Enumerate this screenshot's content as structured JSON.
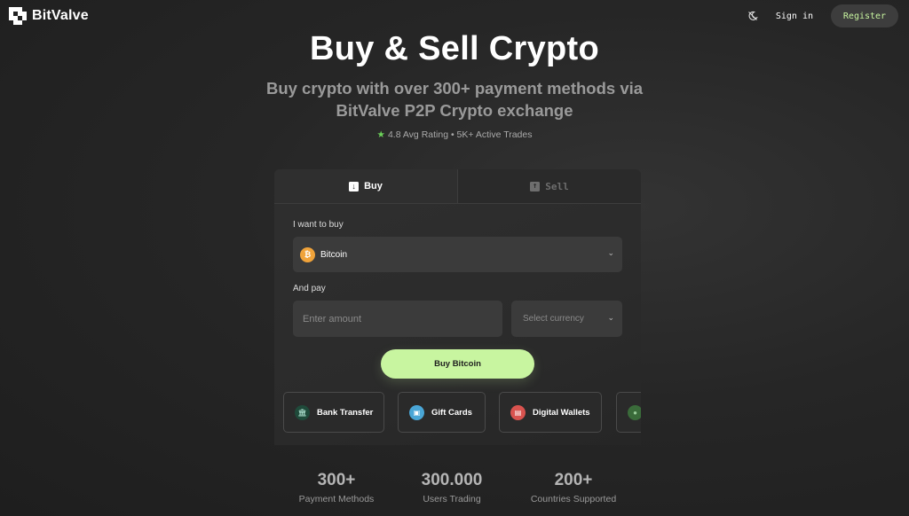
{
  "header": {
    "brand": "BitValve",
    "theme_icon": "moon-slash-icon",
    "signin_label": "Sign in",
    "register_label": "Register"
  },
  "hero": {
    "title": "Buy & Sell Crypto",
    "subtitle_line1": "Buy crypto with over 300+ payment methods via",
    "subtitle_line2": "BitValve P2P Crypto exchange",
    "rating_text": "4.8 Avg Rating • 5K+ Active Trades"
  },
  "card": {
    "tabs": [
      {
        "label": "Buy",
        "icon": "download-icon",
        "active": true
      },
      {
        "label": "Sell",
        "icon": "upload-icon",
        "active": false
      }
    ],
    "want_label": "I want to buy",
    "coin": {
      "name": "Bitcoin",
      "icon": "bitcoin-icon",
      "symbol": "₿"
    },
    "pay_label": "And pay",
    "amount_placeholder": "Enter amount",
    "currency_placeholder": "Select currency",
    "buy_button": "Buy Bitcoin"
  },
  "payment_methods": [
    {
      "label": "Bank Transfer",
      "icon": "bank-icon",
      "color": "#1f4a3a"
    },
    {
      "label": "Gift Cards",
      "icon": "gift-card-icon",
      "color": "#4aa6d6"
    },
    {
      "label": "Digital Wallets",
      "icon": "wallet-icon",
      "color": "#d9534f"
    },
    {
      "label": "",
      "icon": "crypto-icon",
      "color": "#3a6b3a"
    }
  ],
  "stats": [
    {
      "value": "300+",
      "label": "Payment Methods"
    },
    {
      "value": "300.000",
      "label": "Users Trading"
    },
    {
      "value": "200+",
      "label": "Countries Supported"
    }
  ],
  "colors": {
    "accent": "#c8f5a0",
    "background": "#262626",
    "card": "#2f2f2f",
    "bitcoin": "#f0a33a",
    "star": "#6cd35a"
  }
}
